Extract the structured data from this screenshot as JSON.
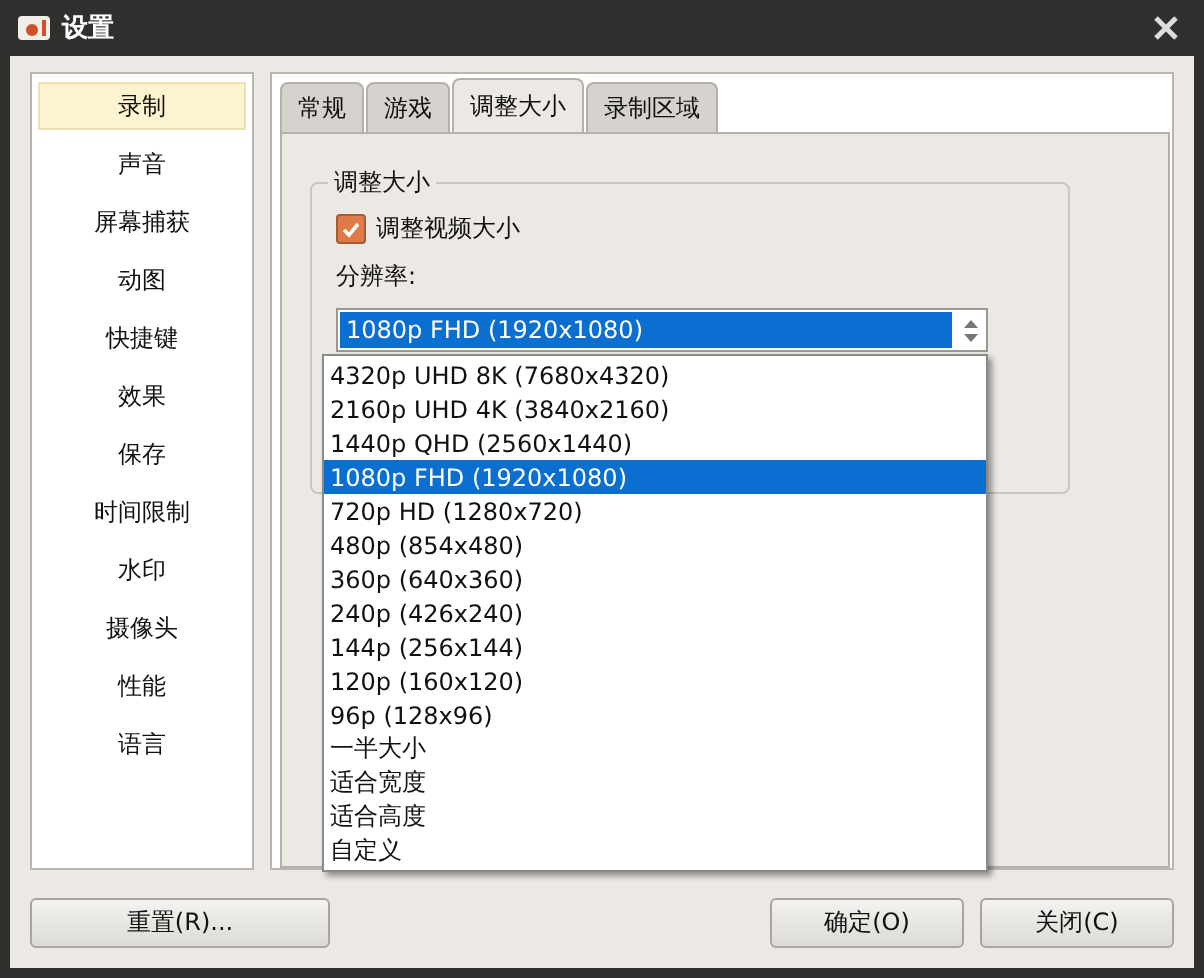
{
  "window": {
    "title": "设置"
  },
  "sidebar": {
    "items": [
      {
        "label": "录制",
        "selected": true
      },
      {
        "label": "声音",
        "selected": false
      },
      {
        "label": "屏幕捕获",
        "selected": false
      },
      {
        "label": "动图",
        "selected": false
      },
      {
        "label": "快捷键",
        "selected": false
      },
      {
        "label": "效果",
        "selected": false
      },
      {
        "label": "保存",
        "selected": false
      },
      {
        "label": "时间限制",
        "selected": false
      },
      {
        "label": "水印",
        "selected": false
      },
      {
        "label": "摄像头",
        "selected": false
      },
      {
        "label": "性能",
        "selected": false
      },
      {
        "label": "语言",
        "selected": false
      }
    ]
  },
  "tabs": [
    {
      "label": "常规",
      "selected": false
    },
    {
      "label": "游戏",
      "selected": false
    },
    {
      "label": "调整大小",
      "selected": true
    },
    {
      "label": "录制区域",
      "selected": false
    }
  ],
  "group": {
    "title": "调整大小",
    "checkbox": {
      "label": "调整视频大小",
      "checked": true
    },
    "resolution_label": "分辨率:",
    "value": "1080p FHD (1920x1080)",
    "options": [
      {
        "label": "4320p UHD 8K (7680x4320)",
        "selected": false
      },
      {
        "label": "2160p UHD 4K (3840x2160)",
        "selected": false
      },
      {
        "label": "1440p QHD (2560x1440)",
        "selected": false
      },
      {
        "label": "1080p FHD (1920x1080)",
        "selected": true
      },
      {
        "label": "720p HD (1280x720)",
        "selected": false
      },
      {
        "label": "480p (854x480)",
        "selected": false
      },
      {
        "label": "360p (640x360)",
        "selected": false
      },
      {
        "label": "240p (426x240)",
        "selected": false
      },
      {
        "label": "144p (256x144)",
        "selected": false
      },
      {
        "label": "120p (160x120)",
        "selected": false
      },
      {
        "label": "96p (128x96)",
        "selected": false
      },
      {
        "label": "一半大小",
        "selected": false
      },
      {
        "label": "适合宽度",
        "selected": false
      },
      {
        "label": "适合高度",
        "selected": false
      },
      {
        "label": "自定义",
        "selected": false
      }
    ]
  },
  "buttons": {
    "reset": "重置(R)...",
    "ok": "确定(O)",
    "close": "关闭(C)"
  }
}
